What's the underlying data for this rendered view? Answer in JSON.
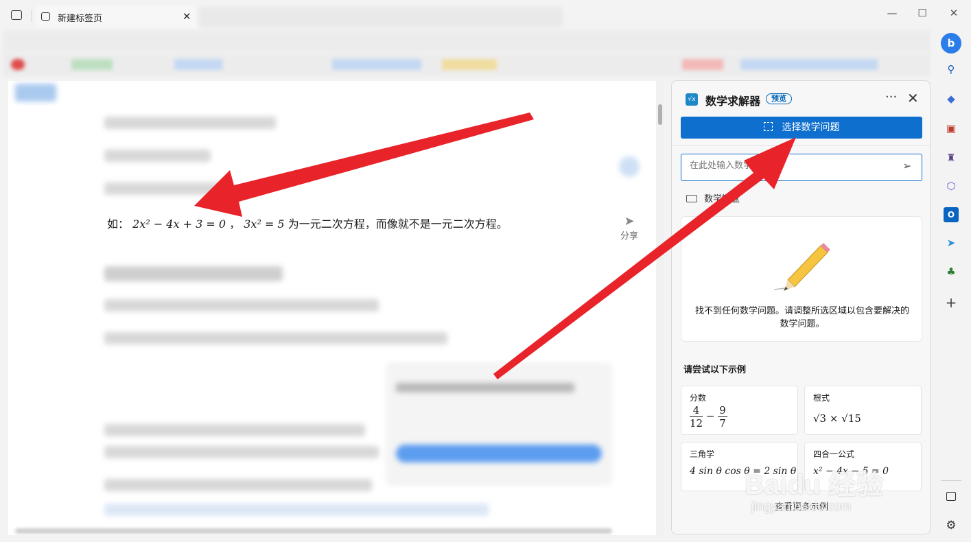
{
  "browser": {
    "tab_title": "新建标签页"
  },
  "content": {
    "formula_prefix": "如：",
    "eq1": "2x² − 4x + 3 = 0",
    "sep": "，",
    "eq2": "3x² = 5",
    "formula_suffix": "为一元二次方程，而像就不是一元二次方程。",
    "share_label": "分享"
  },
  "panel": {
    "title": "数学求解器",
    "badge": "预览",
    "select_button": "选择数学问题",
    "input_placeholder": "在此处输入数学问题",
    "keyboard_label": "数学键盘",
    "info_text": "找不到任何数学问题。请调整所选区域以包含要解决的数学问题。",
    "examples_title": "请尝试以下示例",
    "examples": [
      {
        "label": "分数",
        "formula": "4/12 − 9/7"
      },
      {
        "label": "根式",
        "formula": "√3 × √15"
      },
      {
        "label": "三角学",
        "formula": "4 sin θ cos θ = 2 sin θ"
      },
      {
        "label": "四合一公式",
        "formula": "x² − 4x − 5 = 0"
      }
    ],
    "more_examples": "查看更多示例"
  },
  "fraction": {
    "a_num": "4",
    "a_den": "12",
    "op": "−",
    "b_num": "9",
    "b_den": "7"
  },
  "watermark": {
    "logo": "Baidu 经验",
    "url": "jingyan.baidu.com"
  },
  "colors": {
    "accent": "#0f6fcf",
    "arrow": "#e8232a"
  }
}
